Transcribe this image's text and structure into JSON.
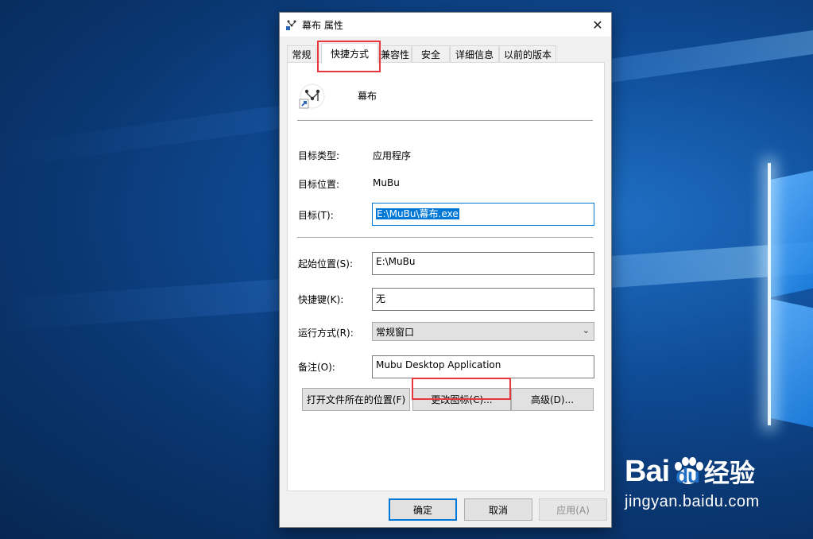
{
  "window": {
    "title": "幕布 属性",
    "close_glyph": "✕"
  },
  "tabs": [
    {
      "label": "常规",
      "active": false
    },
    {
      "label": "快捷方式",
      "active": true
    },
    {
      "label": "兼容性",
      "active": false
    },
    {
      "label": "安全",
      "active": false
    },
    {
      "label": "详细信息",
      "active": false
    },
    {
      "label": "以前的版本",
      "active": false
    }
  ],
  "shortcut": {
    "name": "幕布",
    "target_type_label": "目标类型:",
    "target_type_value": "应用程序",
    "target_location_label": "目标位置:",
    "target_location_value": "MuBu",
    "target_label": "目标(T):",
    "target_value": "E:\\MuBu\\幕布.exe",
    "start_in_label": "起始位置(S):",
    "start_in_value": "E:\\MuBu",
    "hotkey_label": "快捷键(K):",
    "hotkey_value": "无",
    "run_label": "运行方式(R):",
    "run_value": "常规窗口",
    "comment_label": "备注(O):",
    "comment_value": "Mubu Desktop Application"
  },
  "actions": {
    "open_location": "打开文件所在的位置(F)",
    "change_icon": "更改图标(C)...",
    "advanced": "高级(D)..."
  },
  "footer": {
    "ok": "确定",
    "cancel": "取消",
    "apply": "应用(A)"
  },
  "watermark": {
    "brand_left": "Bai",
    "brand_mid": "du",
    "brand_right": "经验",
    "url": "jingyan.baidu.com"
  },
  "colors": {
    "accent": "#0078d7",
    "highlight": "#e8363c"
  }
}
